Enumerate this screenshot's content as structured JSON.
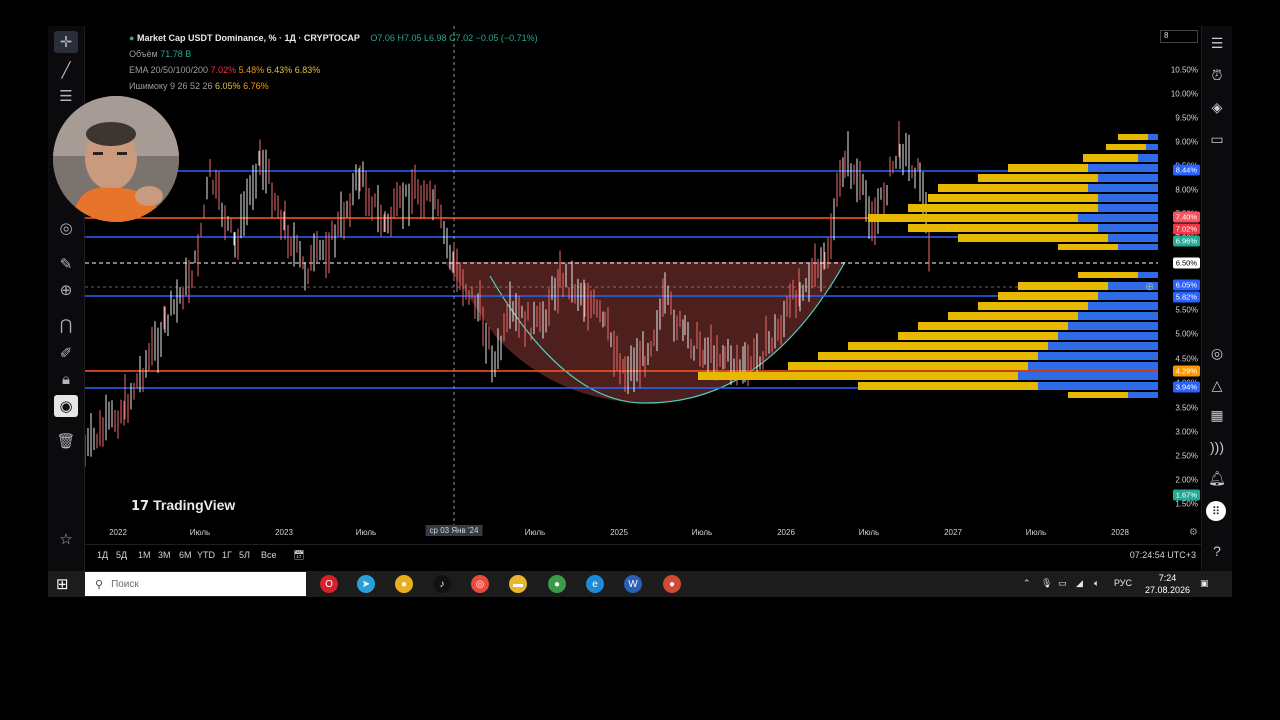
{
  "legend": {
    "symbol_line": "Market Cap USDT Dominance, % · 1Д · CRYPTOCAP",
    "ohlc_o": "O7.06",
    "ohlc_h": "H7.05",
    "ohlc_l": "L6.98",
    "ohlc_c": "C7.02",
    "change": "−0.05 (−0.71%)",
    "volume_label": "Объём",
    "volume_value": "71.78 B",
    "ema_label": "EMA 20/50/100/200",
    "ema_values": [
      "7.02%",
      "5.48%",
      "6.43%",
      "6.83%"
    ],
    "ichimoku_label": "Ишимоку 9 26 52 26",
    "ichimoku_values": [
      "6.05%",
      "6.76%"
    ]
  },
  "price_axis": {
    "ticks": [
      "10.50%",
      "10.00%",
      "9.50%",
      "9.00%",
      "8.50%",
      "8.00%",
      "7.50%",
      "7.00%",
      "6.50%",
      "6.00%",
      "5.50%",
      "5.00%",
      "4.50%",
      "4.00%",
      "3.50%",
      "3.00%",
      "2.50%",
      "2.00%",
      "1.50%"
    ],
    "labels": [
      {
        "text": "8.44%",
        "color": "#2962ff"
      },
      {
        "text": "7.40%",
        "color": "#f7525f"
      },
      {
        "text": "7.02%",
        "color": "#f23645"
      },
      {
        "text": "6.96%",
        "color": "#22ab94"
      },
      {
        "text": "6.50%",
        "color": "#ffffff"
      },
      {
        "text": "6.05%",
        "color": "#2962ff"
      },
      {
        "text": "5.82%",
        "color": "#2962ff"
      },
      {
        "text": "4.29%",
        "color": "#ff9800"
      },
      {
        "text": "3.94%",
        "color": "#2962ff"
      },
      {
        "text": "1.67%",
        "color": "#22ab94"
      }
    ],
    "top_input": "8"
  },
  "time_axis": {
    "ticks": [
      "2022",
      "Июль",
      "2023",
      "Июль",
      "2024",
      "Июль",
      "2025",
      "Июль",
      "2026",
      "Июль",
      "2027",
      "Июль",
      "2028"
    ],
    "crosshair_label": "ср 03 Янв '24"
  },
  "branding": {
    "logo_text": "TradingView"
  },
  "bottom_bar": {
    "ranges": [
      "1Д",
      "5Д",
      "1М",
      "3М",
      "6М",
      "YTD",
      "1Г",
      "5Л",
      "Все"
    ],
    "clock": "07:24:54 UTC+3"
  },
  "taskbar": {
    "search_placeholder": "Поиск",
    "apps": [
      {
        "name": "opera",
        "color": "#d6202b",
        "glyph": "O"
      },
      {
        "name": "telegram",
        "color": "#2a9fd8",
        "glyph": "➤"
      },
      {
        "name": "chrome",
        "color": "#e8ae1f",
        "glyph": "●"
      },
      {
        "name": "tiktok",
        "color": "#111111",
        "glyph": "♪"
      },
      {
        "name": "app-red",
        "color": "#e74c3c",
        "glyph": "◎"
      },
      {
        "name": "explorer",
        "color": "#e8b52e",
        "glyph": "▬"
      },
      {
        "name": "chrome-2",
        "color": "#3b9b4b",
        "glyph": "●"
      },
      {
        "name": "edge",
        "color": "#1e8ad6",
        "glyph": "e"
      },
      {
        "name": "word",
        "color": "#2b5fb4",
        "glyph": "W"
      },
      {
        "name": "chrome-3",
        "color": "#d04a38",
        "glyph": "●"
      }
    ],
    "lang": "РУС",
    "time": "7:24",
    "date": "27.08.2026"
  },
  "colors": {
    "blue_line": "#2962ff",
    "orange_line": "#ff5722",
    "volume_profile_yellow": "#e6b800",
    "volume_profile_blue": "#2f6be6",
    "cup_fill": "#8c3b36",
    "cup_outline": "#4dd0c4"
  }
}
